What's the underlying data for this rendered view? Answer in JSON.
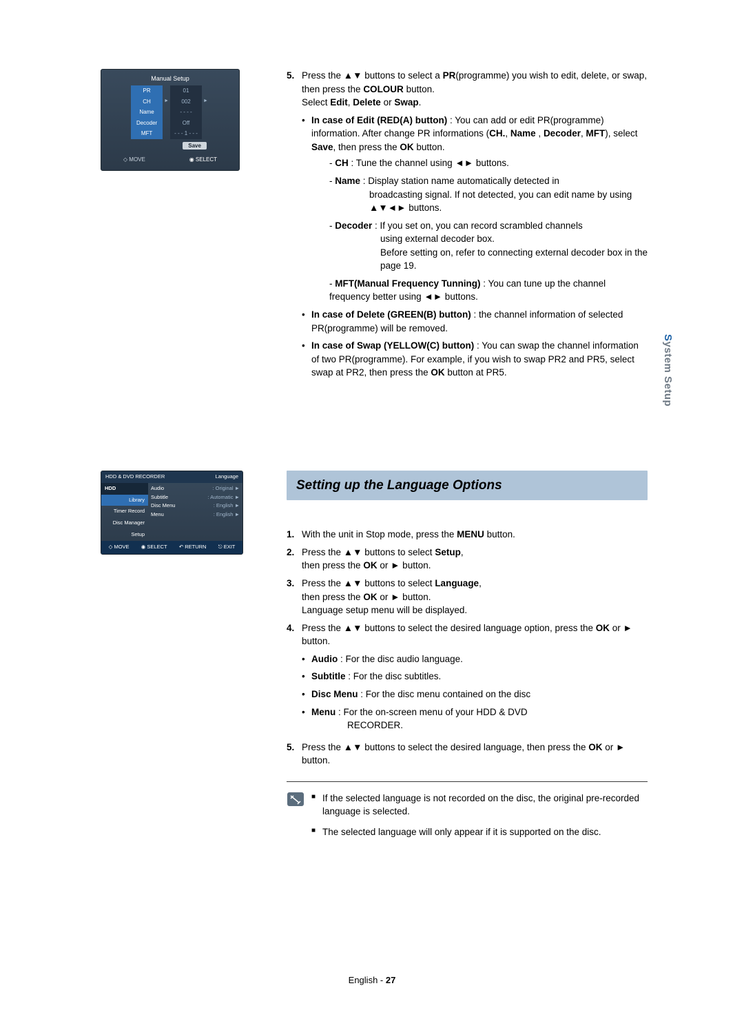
{
  "sideTab": "System Setup",
  "manualMini": {
    "title": "Manual Setup",
    "rows": [
      {
        "label": "PR",
        "value": "01"
      },
      {
        "label": "CH",
        "value": "002",
        "arrows": true
      },
      {
        "label": "Name",
        "value": "- - - -"
      },
      {
        "label": "Decoder",
        "value": "Off"
      },
      {
        "label": "MFT",
        "value": "- - - 1 - - -"
      }
    ],
    "save": "Save",
    "move": "MOVE",
    "select": "SELECT"
  },
  "step5": {
    "num": "5.",
    "intro1": "Press the ▲▼ buttons to select a ",
    "pr": "PR",
    "intro2": "(programme) you wish to edit, delete, or swap, then press the ",
    "colour": "COLOUR",
    "intro3": " button.",
    "selectLine1": "Select ",
    "edit": "Edit",
    "delete": "Delete",
    "swap": "Swap",
    "or": " or ",
    "comma": ", ",
    "period": ".",
    "editHead": "In case of Edit (RED(A) button)",
    "editBody1": " : You can add or edit PR(programme) information. After change PR informations (",
    "chB": "CH.",
    "nameB": "Name",
    "decB": "Decoder",
    "mftB": "MFT",
    "editBody2": "), select ",
    "saveB": "Save",
    "editBody3": ", then press the ",
    "okB": "OK",
    "editBody4": " button.",
    "chLine": " : Tune the channel using ◄► buttons.",
    "chLabel": "CH",
    "nameLabel": "Name",
    "nameLine": " : Display station name automatically detected in broadcasting signal. If not detected, you can edit name by using ▲▼◄► buttons.",
    "decoderLabel": "Decoder",
    "decoderLine": " : If you set on, you can record scrambled channels using external decoder box.",
    "decoderLine2": "Before setting on, refer to connecting external decoder box in the page 19.",
    "mftLabel": "MFT(Manual Frequency Tunning)",
    "mftLine": " : You can tune up the channel frequency better using ◄► buttons.",
    "deleteHead": "In case of Delete (GREEN(B) button)",
    "deleteBody": " : the channel information of selected PR(programme) will be removed.",
    "swapHead": "In case of Swap (YELLOW(C) button)",
    "swapBody1": " : You can swap the channel information of two PR(programme). For example, if you wish to swap PR2 and PR5, select swap at PR2, then press the ",
    "swapBody2": " button at PR5."
  },
  "langMini": {
    "topLeft": "HDD & DVD RECORDER",
    "topRight": "Language",
    "sidebar": [
      "HDD",
      "Library",
      "Timer Record",
      "Disc Manager",
      "Setup"
    ],
    "rows": [
      {
        "k": "Audio",
        "v": ": Original"
      },
      {
        "k": "Subtitle",
        "v": ": Automatic"
      },
      {
        "k": "Disc Menu",
        "v": ": English"
      },
      {
        "k": "Menu",
        "v": ": English"
      }
    ],
    "footer": [
      "MOVE",
      "SELECT",
      "RETURN",
      "EXIT"
    ]
  },
  "sectionTitle": "Setting up the Language Options",
  "langSteps": {
    "s1num": "1.",
    "s1": "With the unit in Stop mode, press the ",
    "menuB": "MENU",
    "s1b": " button.",
    "s2num": "2.",
    "s2a": "Press the ▲▼ buttons to select ",
    "setupB": "Setup",
    "s2b": ",",
    "s2c": "then press the ",
    "okB": "OK",
    "s2d": " or ► button.",
    "s3num": "3.",
    "s3a": "Press the ▲▼ buttons to select ",
    "langB": "Language",
    "s3b": ",",
    "s3c": "then press the ",
    "s3d": " or ► button.",
    "s3e": "Language setup menu will be displayed.",
    "s4num": "4.",
    "s4a": "Press the ▲▼ buttons to select the desired language option, press the ",
    "s4b": " or ► button.",
    "audioB": "Audio",
    "audioT": " : For the disc audio language.",
    "subB": "Subtitle",
    "subT": " : For the disc subtitles.",
    "dmB": "Disc Menu",
    "dmT": " : For the disc menu contained on the disc",
    "menuB2": "Menu",
    "menuT": " : For the on-screen menu of your HDD & DVD RECORDER.",
    "s5num": "5.",
    "s5a": "Press the ▲▼ buttons to select the desired language, then press the ",
    "s5b": " or ► button."
  },
  "notes": {
    "n1": "If the selected language is not recorded on the disc, the original pre-recorded language is selected.",
    "n2": "The selected language will only appear if it is supported on the disc."
  },
  "footer": {
    "lang": "English",
    "sep": " - ",
    "page": "27"
  }
}
